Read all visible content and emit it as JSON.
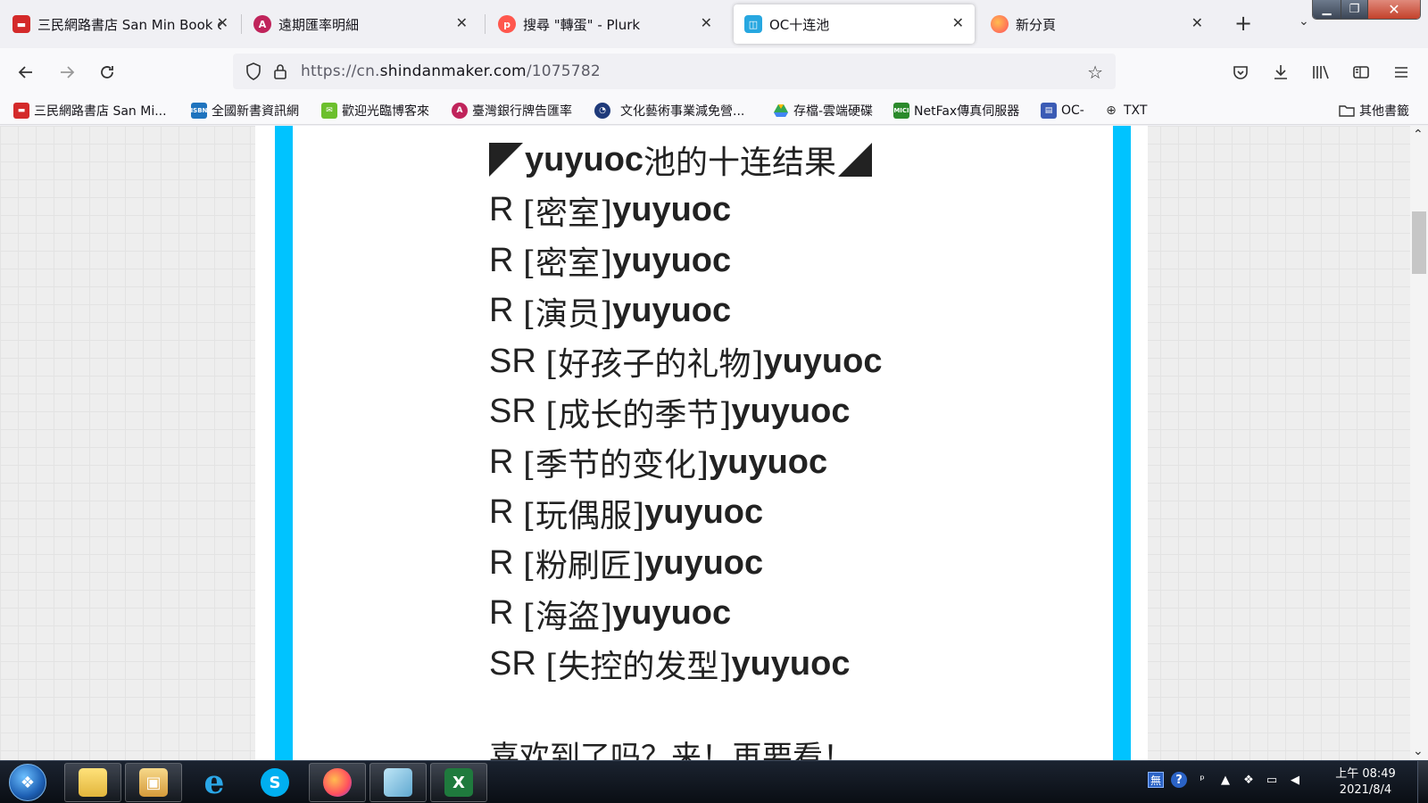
{
  "browser": {
    "tabs": [
      {
        "title": "三民網路書店 San Min Book c",
        "icon": "sanmin-icon",
        "color": "#d42a2a",
        "active": false
      },
      {
        "title": "遠期匯率明細",
        "icon": "bank-icon",
        "color": "#c0245b",
        "active": false
      },
      {
        "title": "搜尋 \"轉蛋\" - Plurk",
        "icon": "plurk-icon",
        "color": "#ff574d",
        "active": false
      },
      {
        "title": "OC十连池",
        "icon": "shindanmaker-icon",
        "color": "#27a7e0",
        "active": true
      },
      {
        "title": "新分頁",
        "icon": "firefox-icon",
        "color": "#ff7139",
        "active": false
      }
    ],
    "url": {
      "scheme": "https://cn.",
      "host": "shindanmaker.com",
      "path": "/1075782"
    },
    "bookmarks": [
      {
        "label": "三民網路書店 San Mi...",
        "icon": "sanmin-icon",
        "color": "#d42a2a"
      },
      {
        "label": "全國新書資訊網",
        "icon": "isbn-icon",
        "color": "#1e73be"
      },
      {
        "label": "歡迎光臨博客來",
        "icon": "books-icon",
        "color": "#6cbf2c"
      },
      {
        "label": "臺灣銀行牌告匯率",
        "icon": "bank-icon",
        "color": "#c0245b"
      },
      {
        "label": "文化藝術事業減免營...",
        "icon": "globe-icon",
        "color": "#1f3a7a"
      },
      {
        "label": "存檔-雲端硬碟",
        "icon": "drive-icon",
        "color": "#34a853"
      },
      {
        "label": "NetFax傳真伺服器",
        "icon": "netfax-icon",
        "color": "#2b8a2b"
      },
      {
        "label": "OC-",
        "icon": "oc-icon",
        "color": "#3b5bb5"
      },
      {
        "label": "TXT",
        "icon": "globe-icon",
        "color": "#555555"
      }
    ],
    "other_bookmarks": "其他書籤"
  },
  "content": {
    "user": "yuyuoc",
    "header_suffix": "池的十连结果",
    "results": [
      {
        "rarity": "R",
        "item": "[密室]",
        "name": "yuyuoc"
      },
      {
        "rarity": "R",
        "item": "[密室]",
        "name": "yuyuoc"
      },
      {
        "rarity": "R",
        "item": "[演员]",
        "name": "yuyuoc"
      },
      {
        "rarity": "SR",
        "item": "[好孩子的礼物]",
        "name": "yuyuoc"
      },
      {
        "rarity": "SR",
        "item": "[成长的季节]",
        "name": "yuyuoc"
      },
      {
        "rarity": "R",
        "item": "[季节的变化]",
        "name": "yuyuoc"
      },
      {
        "rarity": "R",
        "item": "[玩偶服]",
        "name": "yuyuoc"
      },
      {
        "rarity": "R",
        "item": "[粉刷匠]",
        "name": "yuyuoc"
      },
      {
        "rarity": "R",
        "item": "[海盗]",
        "name": "yuyuoc"
      },
      {
        "rarity": "SR",
        "item": "[失控的发型]",
        "name": "yuyuoc"
      }
    ],
    "cutoff_text": "喜欢到了吗？来！再要看！"
  },
  "taskbar": {
    "apps": [
      "explorer-icon",
      "photo-viewer-icon",
      "ie-icon",
      "skype-icon",
      "firefox-icon",
      "notepad-icon",
      "excel-icon"
    ],
    "ime_label": "無",
    "time_period": "上午",
    "time": "08:49",
    "date": "2021/8/4"
  },
  "colors": {
    "accent_bar": "#00c3ff"
  }
}
